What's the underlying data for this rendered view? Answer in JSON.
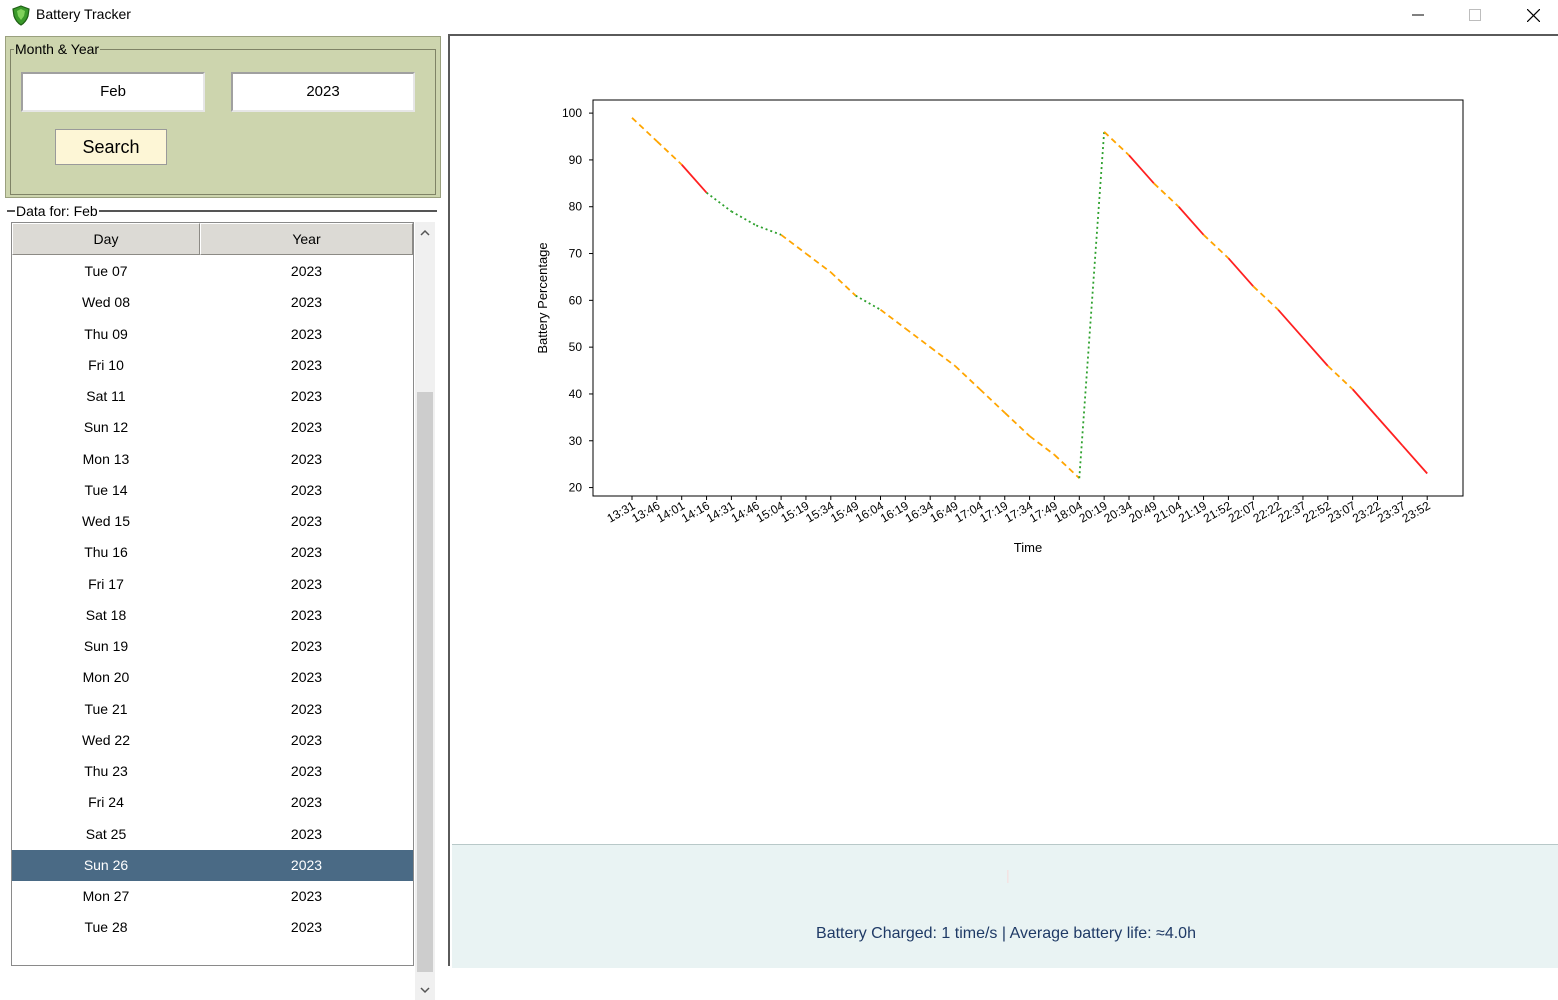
{
  "window": {
    "title": "Battery Tracker",
    "app_icon": "green-shield-icon"
  },
  "search_panel": {
    "legend": "Month & Year",
    "month_value": "Feb",
    "year_value": "2023",
    "search_label": "Search"
  },
  "data_panel": {
    "legend": "Data for: Feb",
    "columns": {
      "day": "Day",
      "year": "Year"
    },
    "rows": [
      {
        "day": "Tue 07",
        "year": "2023"
      },
      {
        "day": "Wed 08",
        "year": "2023"
      },
      {
        "day": "Thu 09",
        "year": "2023"
      },
      {
        "day": "Fri 10",
        "year": "2023"
      },
      {
        "day": "Sat 11",
        "year": "2023"
      },
      {
        "day": "Sun 12",
        "year": "2023"
      },
      {
        "day": "Mon 13",
        "year": "2023"
      },
      {
        "day": "Tue 14",
        "year": "2023"
      },
      {
        "day": "Wed 15",
        "year": "2023"
      },
      {
        "day": "Thu 16",
        "year": "2023"
      },
      {
        "day": "Fri 17",
        "year": "2023"
      },
      {
        "day": "Sat 18",
        "year": "2023"
      },
      {
        "day": "Sun 19",
        "year": "2023"
      },
      {
        "day": "Mon 20",
        "year": "2023"
      },
      {
        "day": "Tue 21",
        "year": "2023"
      },
      {
        "day": "Wed 22",
        "year": "2023"
      },
      {
        "day": "Thu 23",
        "year": "2023"
      },
      {
        "day": "Fri 24",
        "year": "2023"
      },
      {
        "day": "Sat 25",
        "year": "2023"
      },
      {
        "day": "Sun 26",
        "year": "2023",
        "selected": true
      },
      {
        "day": "Mon 27",
        "year": "2023"
      },
      {
        "day": "Tue 28",
        "year": "2023"
      }
    ]
  },
  "status": {
    "summary": "Battery Charged: 1 time/s | Average battery life: ≈4.0h"
  },
  "colors": {
    "panel_bg": "#cdd5ae",
    "selected_row": "#4a6a85",
    "search_button": "#fdf6d6",
    "status_bg": "#e9f3f3",
    "status_text": "#1f3a66",
    "seg_discharge_fast": "#ff2020",
    "seg_discharge": "#ffa500",
    "seg_charge": "#2ca02c"
  },
  "chart_data": {
    "type": "line",
    "title": "",
    "xlabel": "Time",
    "ylabel": "Battery Percentage",
    "ylim": [
      18.2,
      102.8
    ],
    "yticks": [
      20,
      30,
      40,
      50,
      60,
      70,
      80,
      90,
      100
    ],
    "grid": false,
    "x": [
      "13:31",
      "13:46",
      "14:01",
      "14:16",
      "14:31",
      "14:46",
      "15:04",
      "15:19",
      "15:34",
      "15:49",
      "16:04",
      "16:19",
      "16:34",
      "16:49",
      "17:04",
      "17:19",
      "17:34",
      "17:49",
      "18:04",
      "20:19",
      "20:34",
      "20:49",
      "21:04",
      "21:19",
      "21:52",
      "22:07",
      "22:22",
      "22:37",
      "22:52",
      "23:07",
      "23:22",
      "23:37",
      "23:52"
    ],
    "y": [
      99,
      94,
      89,
      83,
      79,
      76,
      74,
      70,
      66,
      61,
      58,
      54,
      50,
      46,
      41,
      36,
      31,
      27,
      22,
      96,
      91,
      85,
      80,
      74,
      69,
      63,
      58,
      52,
      46,
      41,
      35,
      29,
      23
    ],
    "segment_styles": [
      "orange",
      "orange",
      "red",
      "green",
      "green",
      "green",
      "orange",
      "orange",
      "orange",
      "green",
      "orange",
      "orange",
      "orange",
      "orange",
      "orange",
      "orange",
      "orange",
      "orange",
      "green",
      "orange",
      "red",
      "orange",
      "red",
      "orange",
      "red",
      "orange",
      "red",
      "red",
      "orange",
      "red",
      "red",
      "red"
    ]
  }
}
